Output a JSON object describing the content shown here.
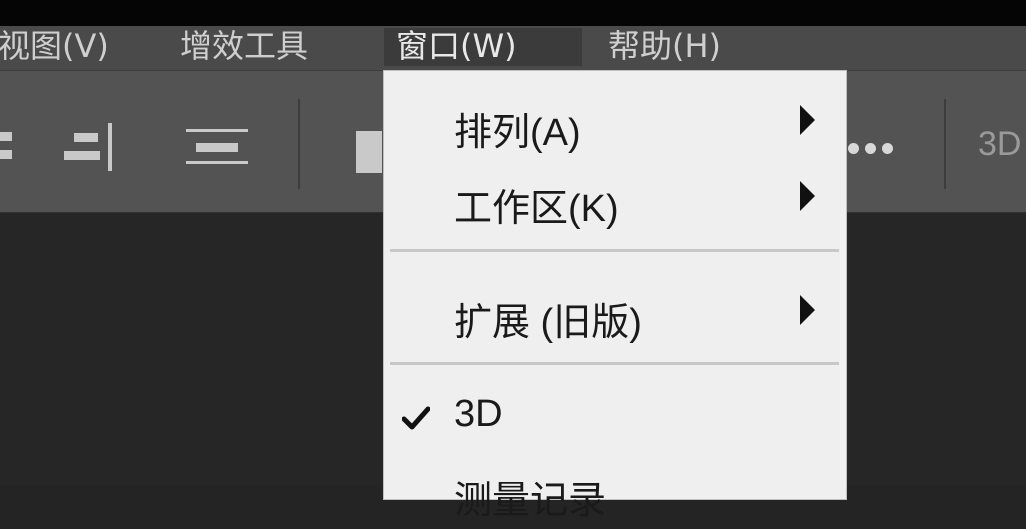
{
  "menubar": {
    "items": [
      {
        "label": "视图(V)"
      },
      {
        "label": "增效工具"
      },
      {
        "label": "窗口(W)"
      },
      {
        "label": "帮助(H)"
      }
    ]
  },
  "toolbar": {
    "label_3d": "3D",
    "icons": [
      "align-left-edges-icon",
      "align-right-edges-icon",
      "distribute-horizontal-icon",
      "align-top-icon",
      "more-options-icon"
    ]
  },
  "window_menu": {
    "items": [
      {
        "label": "排列(A)",
        "submenu": true
      },
      {
        "label": "工作区(K)",
        "submenu": true
      },
      {
        "label": "扩展 (旧版)",
        "submenu": true
      },
      {
        "label": "3D",
        "checked": true
      },
      {
        "label": "测量记录"
      }
    ]
  },
  "colors": {
    "menubar_bg": "#4a4a4a",
    "toolbar_bg": "#535353",
    "dropdown_bg": "#efefef",
    "canvas_bg": "#262626"
  }
}
